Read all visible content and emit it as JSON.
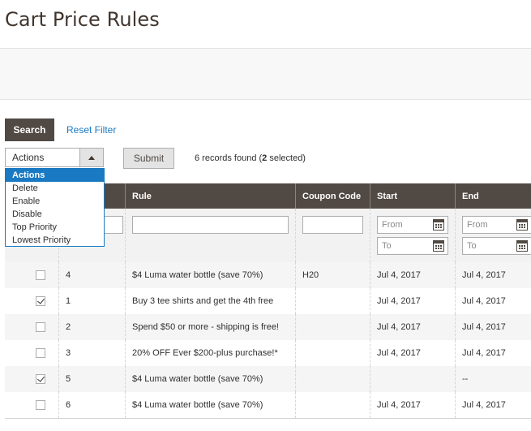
{
  "page": {
    "title": "Cart Price Rules"
  },
  "toolbar": {
    "search_label": "Search",
    "reset_label": "Reset Filter",
    "submit_label": "Submit",
    "records_prefix": "6 records found (",
    "records_selected": "2",
    "records_suffix": " selected)"
  },
  "actions": {
    "selected": "Actions",
    "options": [
      "Actions",
      "Delete",
      "Enable",
      "Disable",
      "Top Priority",
      "Lowest Priority"
    ]
  },
  "grid": {
    "columns": [
      "",
      "",
      "Rule",
      "Coupon Code",
      "Start",
      "End"
    ],
    "filters": {
      "from_placeholder": "From",
      "to_placeholder": "To"
    },
    "rows": [
      {
        "checked": false,
        "id": "4",
        "rule": "$4 Luma water bottle (save 70%)",
        "coupon": "H20",
        "start": "Jul 4, 2017",
        "end": "Jul 4, 2017"
      },
      {
        "checked": true,
        "id": "1",
        "rule": "Buy 3 tee shirts and get the 4th free",
        "coupon": "",
        "start": "Jul 4, 2017",
        "end": "Jul 4, 2017"
      },
      {
        "checked": false,
        "id": "2",
        "rule": "Spend $50 or more - shipping is free!",
        "coupon": "",
        "start": "Jul 4, 2017",
        "end": "Jul 4, 2017"
      },
      {
        "checked": false,
        "id": "3",
        "rule": "20% OFF Ever $200-plus purchase!*",
        "coupon": "",
        "start": "Jul 4, 2017",
        "end": "Jul 4, 2017"
      },
      {
        "checked": true,
        "id": "5",
        "rule": "$4 Luma water bottle (save 70%)",
        "coupon": "",
        "start": "",
        "end": "--"
      },
      {
        "checked": false,
        "id": "6",
        "rule": "$4 Luma water bottle (save 70%)",
        "coupon": "",
        "start": "Jul 4, 2017",
        "end": "Jul 4, 2017"
      }
    ]
  },
  "colors": {
    "header_bg": "#514943",
    "link": "#1979c3",
    "accent": "#1979c3"
  }
}
